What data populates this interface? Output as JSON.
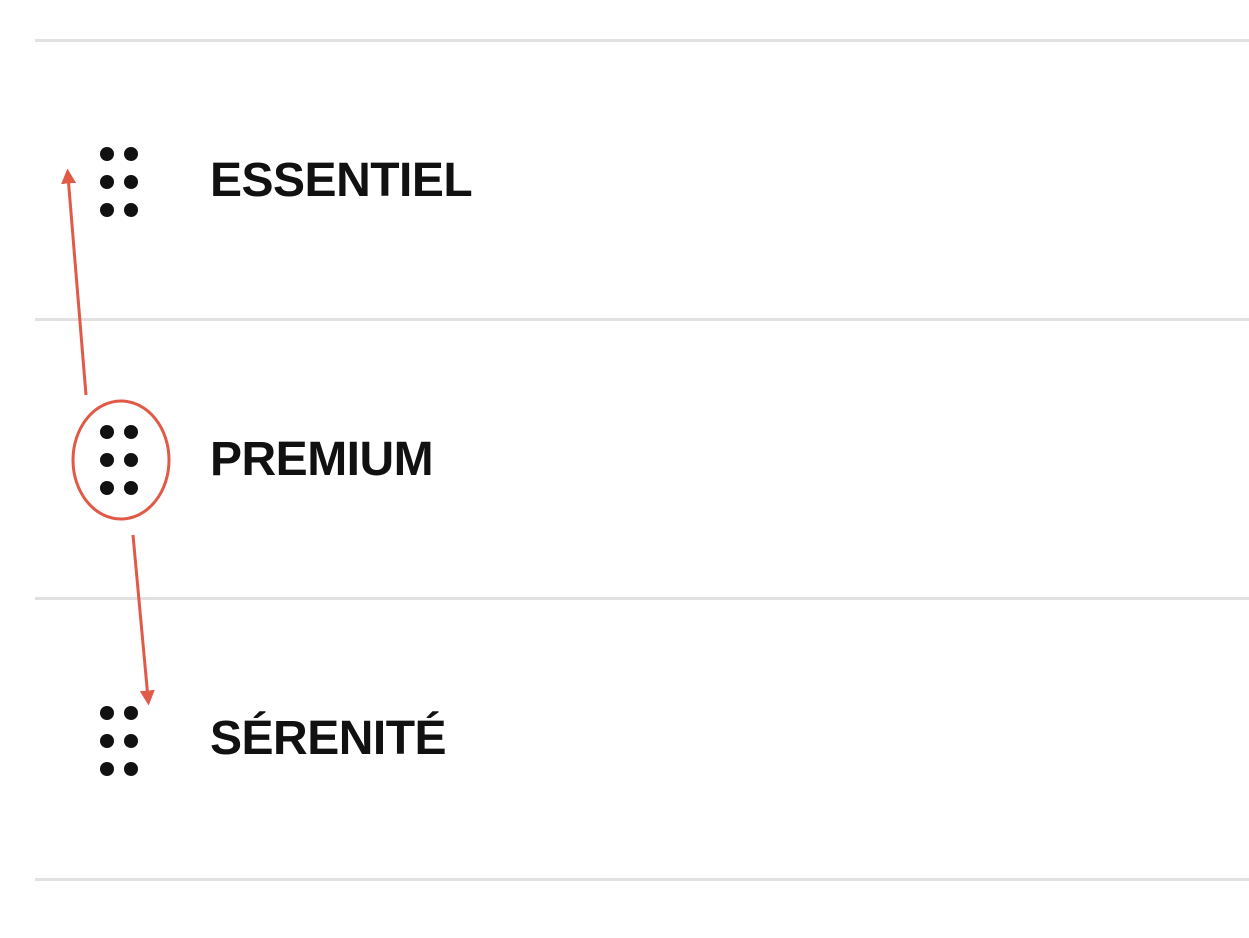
{
  "plans": [
    {
      "label": "ESSENTIEL",
      "handle_icon": "grip-dots-icon"
    },
    {
      "label": "PREMIUM",
      "handle_icon": "grip-dots-icon"
    },
    {
      "label": "SÉRENITÉ",
      "handle_icon": "grip-dots-icon"
    }
  ],
  "annotation": {
    "color": "#e05a47",
    "highlighted_row": "PREMIUM",
    "arrows": [
      "up",
      "down"
    ]
  }
}
